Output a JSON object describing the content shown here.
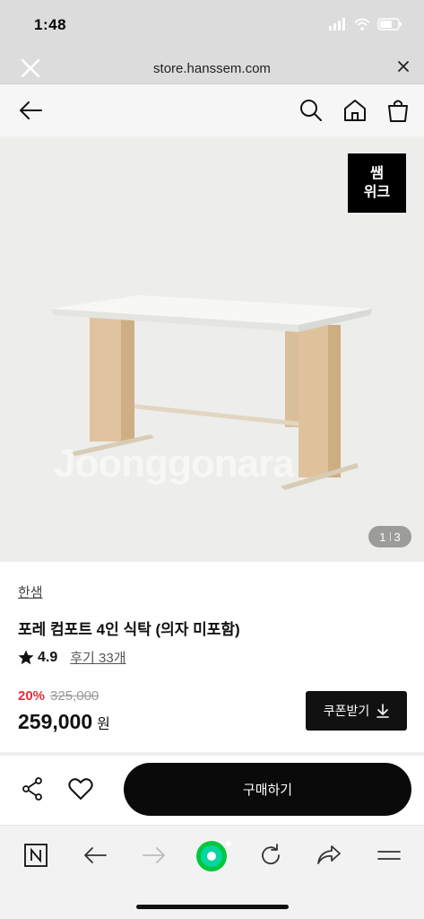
{
  "status": {
    "time": "1:48"
  },
  "browser": {
    "url": "store.hanssem.com"
  },
  "icons": {
    "back": "arrow-left-icon",
    "search": "search-icon",
    "home": "home-icon",
    "bag": "shopping-bag-icon",
    "share": "share-icon",
    "heart": "heart-icon",
    "download": "download-icon",
    "star": "star-icon"
  },
  "product": {
    "badge_line1": "쌤",
    "badge_line2": "위크",
    "watermark": "Joonggonara",
    "pager_current": "1",
    "pager_total": "3",
    "brand": "한샘",
    "title": "포레 컴포트 4인 식탁 (의자 미포함)",
    "rating": "4.9",
    "reviews": "후기 33개",
    "discount": "20%",
    "original_price": "325,000",
    "price": "259,000",
    "currency": "원",
    "coupon_label": "쿠폰받기"
  },
  "actions": {
    "buy_label": "구매하기"
  },
  "colors": {
    "accent_red": "#e4303b",
    "dark": "#111111",
    "naver_green": "#00c73c"
  }
}
